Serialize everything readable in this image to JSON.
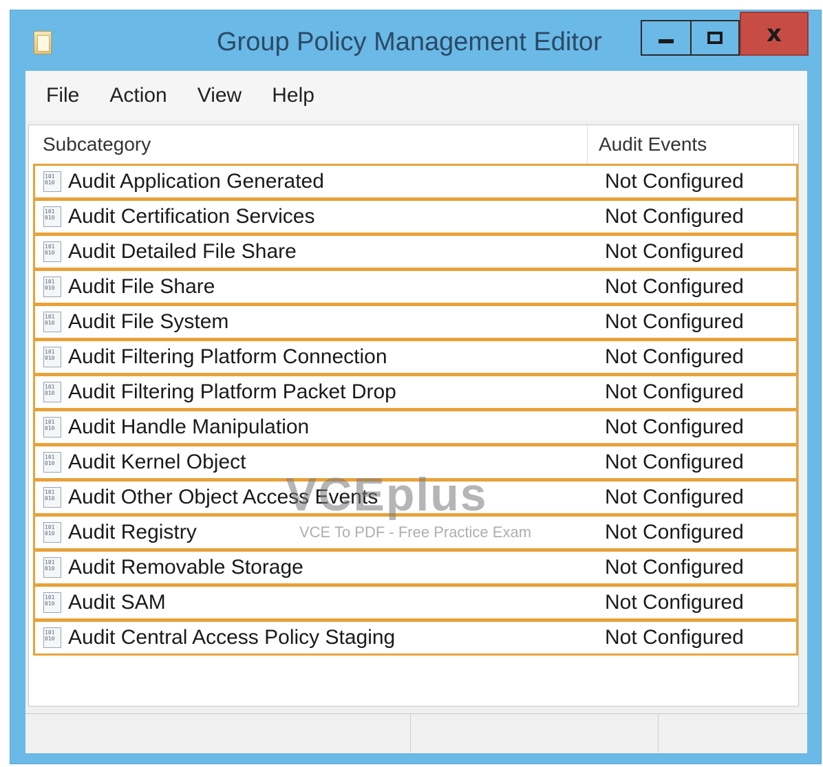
{
  "window": {
    "title": "Group Policy Management Editor",
    "controls": {
      "minimize": "−",
      "maximize": "□",
      "close": "x"
    }
  },
  "menu": {
    "items": [
      "File",
      "Action",
      "View",
      "Help"
    ]
  },
  "table": {
    "columns": [
      "Subcategory",
      "Audit Events"
    ],
    "rows": [
      {
        "subcategory": "Audit Application Generated",
        "audit_events": "Not Configured"
      },
      {
        "subcategory": "Audit Certification Services",
        "audit_events": "Not Configured"
      },
      {
        "subcategory": "Audit Detailed File Share",
        "audit_events": "Not Configured"
      },
      {
        "subcategory": "Audit File Share",
        "audit_events": "Not Configured"
      },
      {
        "subcategory": "Audit File System",
        "audit_events": "Not Configured"
      },
      {
        "subcategory": "Audit Filtering Platform Connection",
        "audit_events": "Not Configured"
      },
      {
        "subcategory": "Audit Filtering Platform Packet Drop",
        "audit_events": "Not Configured"
      },
      {
        "subcategory": "Audit Handle Manipulation",
        "audit_events": "Not Configured"
      },
      {
        "subcategory": "Audit Kernel Object",
        "audit_events": "Not Configured"
      },
      {
        "subcategory": "Audit Other Object Access Events",
        "audit_events": "Not Configured"
      },
      {
        "subcategory": "Audit Registry",
        "audit_events": "Not Configured"
      },
      {
        "subcategory": "Audit Removable Storage",
        "audit_events": "Not Configured"
      },
      {
        "subcategory": "Audit SAM",
        "audit_events": "Not Configured"
      },
      {
        "subcategory": "Audit Central Access Policy Staging",
        "audit_events": "Not Configured"
      }
    ]
  },
  "watermark": {
    "main": "VCEplus",
    "sub": "VCE To PDF - Free Practice Exam"
  },
  "colors": {
    "titlebar": "#6bb9e6",
    "close": "#c74d44",
    "row_highlight": "#e8a23a"
  },
  "icons": {
    "app": "policy-app-icon",
    "row": "binary-setting-icon"
  }
}
